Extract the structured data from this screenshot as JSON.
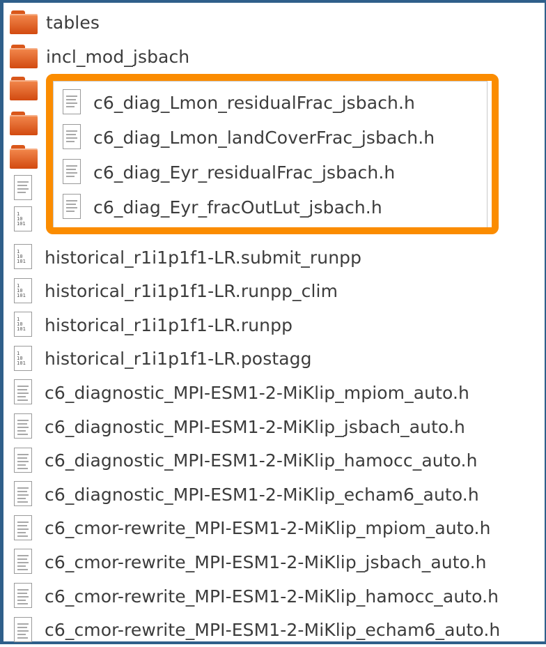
{
  "file_browser": {
    "folders": [
      {
        "label": "tables"
      },
      {
        "label": "incl_mod_jsbach"
      }
    ],
    "highlighted_files": [
      {
        "label": "c6_diag_Lmon_residualFrac_jsbach.h"
      },
      {
        "label": "c6_diag_Lmon_landCoverFrac_jsbach.h"
      },
      {
        "label": "c6_diag_Eyr_residualFrac_jsbach.h"
      },
      {
        "label": "c6_diag_Eyr_fracOutLut_jsbach.h"
      }
    ],
    "files": [
      {
        "label": "historical_r1i1p1f1-LR.submit_runpp",
        "icon": "binary-file-icon"
      },
      {
        "label": "historical_r1i1p1f1-LR.runpp_clim",
        "icon": "binary-file-icon"
      },
      {
        "label": "historical_r1i1p1f1-LR.runpp",
        "icon": "binary-file-icon"
      },
      {
        "label": "historical_r1i1p1f1-LR.postagg",
        "icon": "binary-file-icon"
      },
      {
        "label": "c6_diagnostic_MPI-ESM1-2-MiKlip_mpiom_auto.h",
        "icon": "text-file-icon"
      },
      {
        "label": "c6_diagnostic_MPI-ESM1-2-MiKlip_jsbach_auto.h",
        "icon": "text-file-icon"
      },
      {
        "label": "c6_diagnostic_MPI-ESM1-2-MiKlip_hamocc_auto.h",
        "icon": "text-file-icon"
      },
      {
        "label": "c6_diagnostic_MPI-ESM1-2-MiKlip_echam6_auto.h",
        "icon": "text-file-icon"
      },
      {
        "label": "c6_cmor-rewrite_MPI-ESM1-2-MiKlip_mpiom_auto.h",
        "icon": "text-file-icon"
      },
      {
        "label": "c6_cmor-rewrite_MPI-ESM1-2-MiKlip_jsbach_auto.h",
        "icon": "text-file-icon"
      },
      {
        "label": "c6_cmor-rewrite_MPI-ESM1-2-MiKlip_hamocc_auto.h",
        "icon": "text-file-icon"
      },
      {
        "label": "c6_cmor-rewrite_MPI-ESM1-2-MiKlip_echam6_auto.h",
        "icon": "text-file-icon"
      }
    ],
    "colors": {
      "highlight_border": "#fb8c00",
      "folder": "#e0601f",
      "window_border": "#2f5f8a"
    }
  }
}
